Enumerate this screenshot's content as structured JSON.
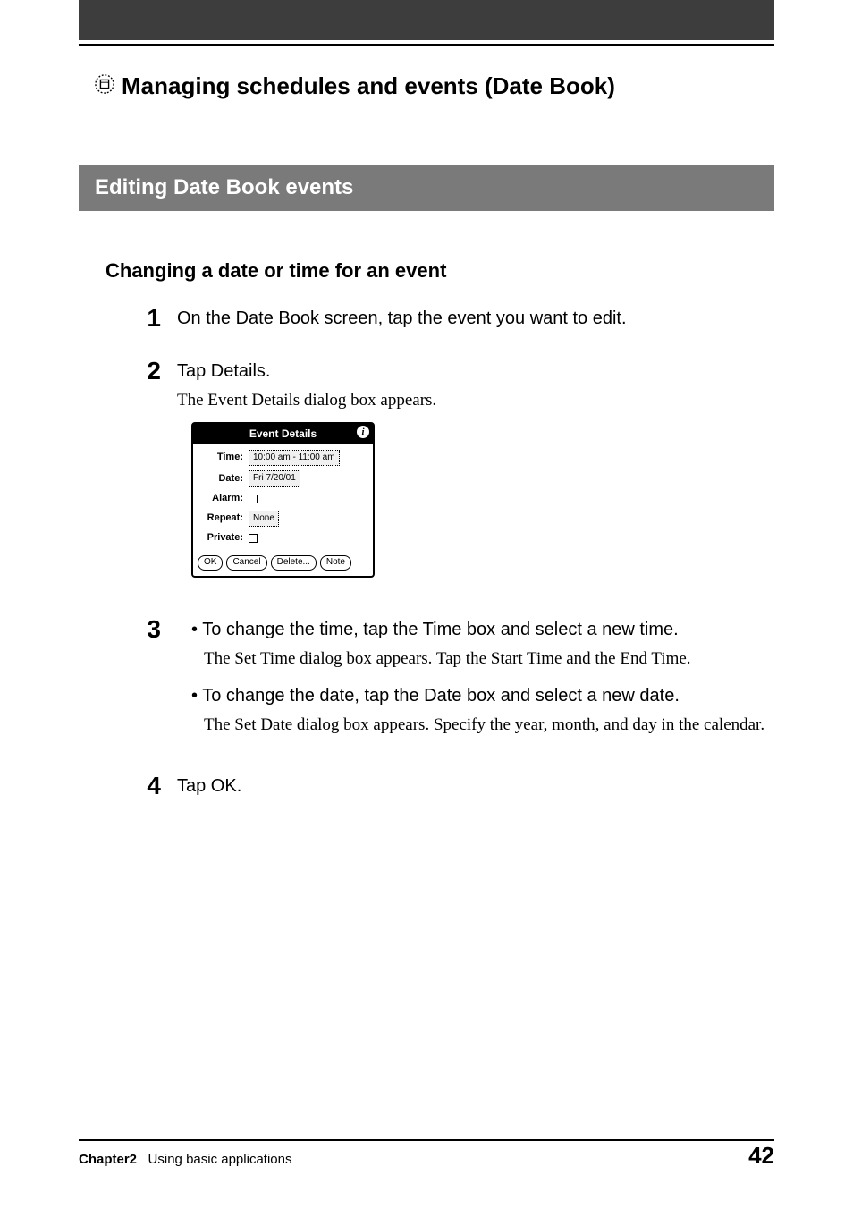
{
  "header": {
    "page_title": "Managing schedules and events (Date Book)"
  },
  "section": {
    "title": "Editing Date Book events"
  },
  "subheading": "Changing a date or time for an event",
  "steps": {
    "s1": {
      "num": "1",
      "text": "On the Date Book screen, tap the event you want to edit."
    },
    "s2": {
      "num": "2",
      "text": "Tap Details.",
      "note": "The Event Details dialog box appears."
    },
    "s3": {
      "num": "3",
      "b1": "• To change the time, tap the Time box and select a new time.",
      "b1note": "The Set Time dialog box appears. Tap the Start Time and the End Time.",
      "b2": "• To change the date, tap the Date box and select a new date.",
      "b2note": "The Set Date dialog box appears. Specify the year, month, and day in the calendar."
    },
    "s4": {
      "num": "4",
      "text": "Tap OK."
    }
  },
  "dialog": {
    "title": "Event Details",
    "info_glyph": "i",
    "time_label": "Time:",
    "time_value": "10:00 am - 11:00 am",
    "date_label": "Date:",
    "date_value": "Fri 7/20/01",
    "alarm_label": "Alarm:",
    "repeat_label": "Repeat:",
    "repeat_value": "None",
    "private_label": "Private:",
    "btn_ok": "OK",
    "btn_cancel": "Cancel",
    "btn_delete": "Delete...",
    "btn_note": "Note"
  },
  "footer": {
    "chapter_bold": "Chapter2",
    "chapter_rest": "Using basic applications",
    "page": "42"
  }
}
